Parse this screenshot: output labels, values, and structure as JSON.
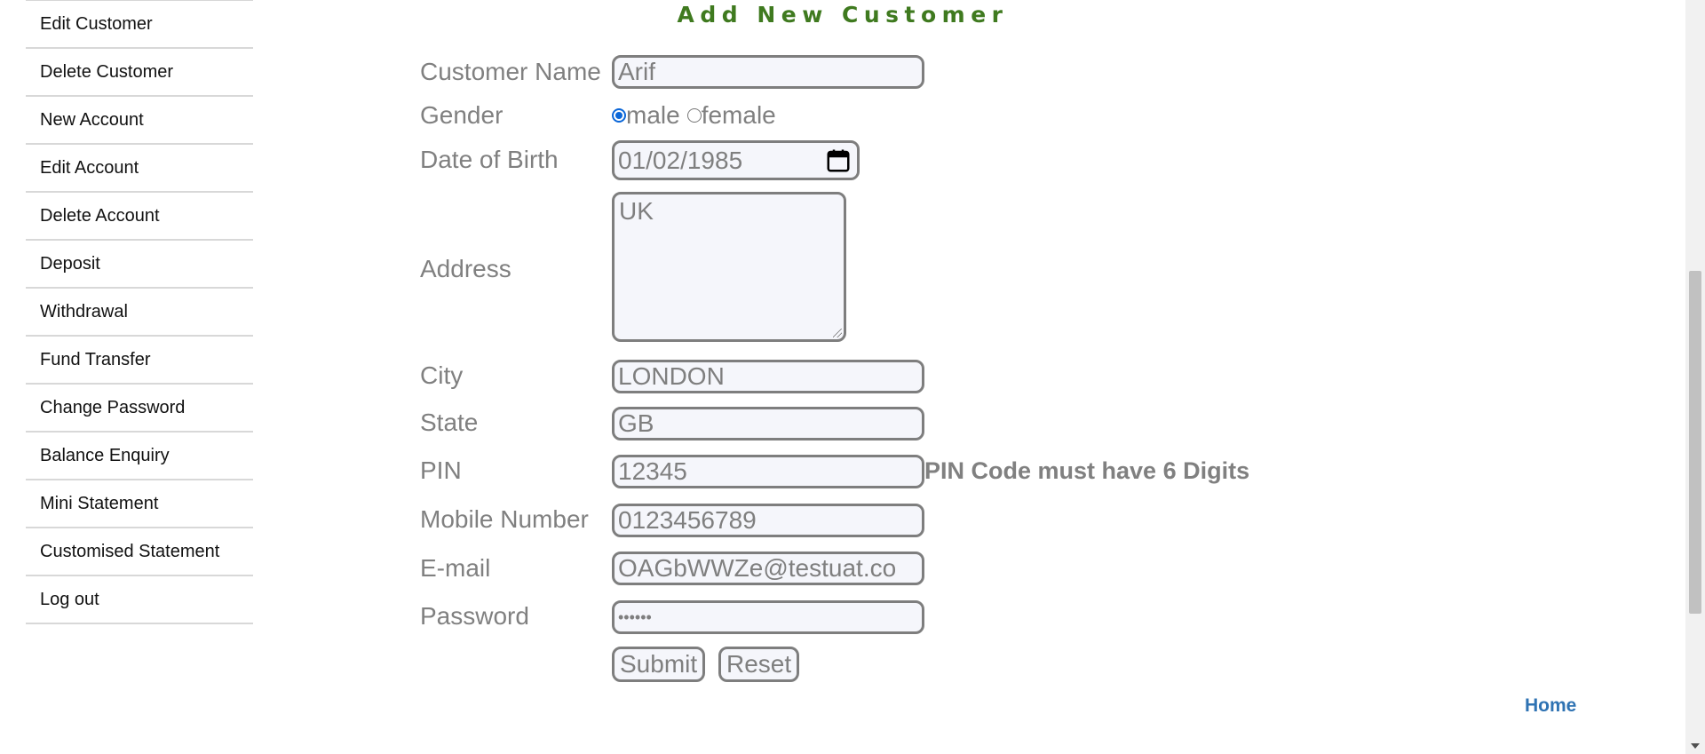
{
  "sidebar": {
    "items": [
      {
        "label": "Edit Customer"
      },
      {
        "label": "Delete Customer"
      },
      {
        "label": "New Account"
      },
      {
        "label": "Edit Account"
      },
      {
        "label": "Delete Account"
      },
      {
        "label": "Deposit"
      },
      {
        "label": "Withdrawal"
      },
      {
        "label": "Fund Transfer"
      },
      {
        "label": "Change Password"
      },
      {
        "label": "Balance Enquiry"
      },
      {
        "label": "Mini Statement"
      },
      {
        "label": "Customised Statement"
      },
      {
        "label": "Log out"
      }
    ]
  },
  "form": {
    "title": "Add New Customer",
    "customer_name": {
      "label": "Customer Name",
      "value": "Arif"
    },
    "gender": {
      "label": "Gender",
      "options": [
        "male",
        "female"
      ],
      "selected": "male"
    },
    "dob": {
      "label": "Date of Birth",
      "value": "01/02/1985"
    },
    "address": {
      "label": "Address",
      "value": "UK"
    },
    "city": {
      "label": "City",
      "value": "LONDON"
    },
    "state": {
      "label": "State",
      "value": "GB"
    },
    "pin": {
      "label": "PIN",
      "value": "12345",
      "error": "PIN Code must have 6 Digits"
    },
    "mobile": {
      "label": "Mobile Number",
      "value": "0123456789"
    },
    "email": {
      "label": "E-mail",
      "value": "OAGbWWZe@testuat.co"
    },
    "password": {
      "label": "Password",
      "value": "••••••"
    },
    "submit_label": "Submit",
    "reset_label": "Reset"
  },
  "footer": {
    "home_link": "Home"
  },
  "colors": {
    "title": "#3f7a1f",
    "link": "#2f73b3",
    "radio_checked": "#0a66d8"
  }
}
